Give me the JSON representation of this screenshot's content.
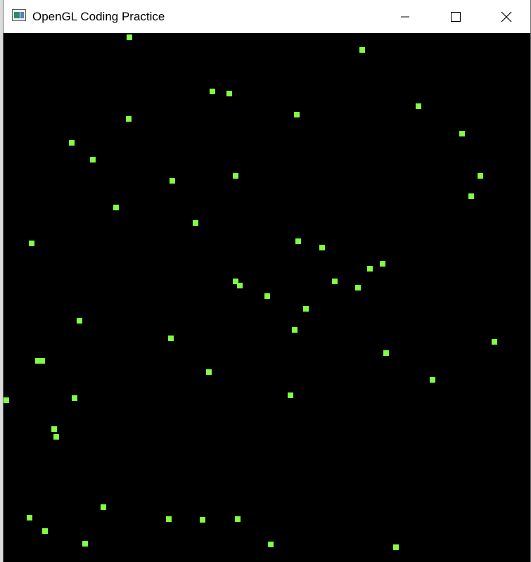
{
  "window": {
    "title": "OpenGL Coding Practice",
    "controls": {
      "minimize": "minimize-icon",
      "maximize": "maximize-icon",
      "close": "close-icon"
    }
  },
  "canvas": {
    "background": "#000000",
    "point_color": "#80ff40"
  }
}
